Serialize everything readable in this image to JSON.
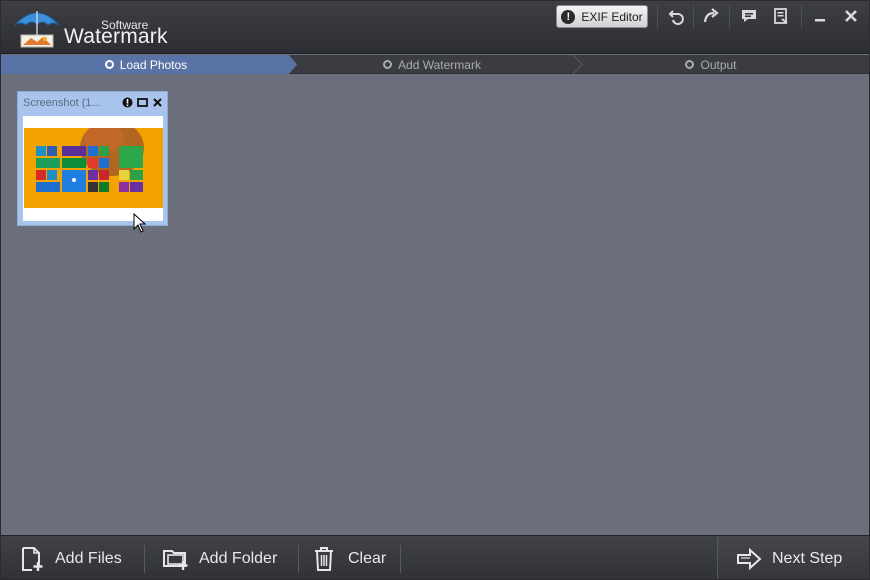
{
  "app": {
    "brand_small": "Software",
    "brand_big": "Watermark"
  },
  "toolbar": {
    "exif_label": "EXIF Editor",
    "exif_icon": "exclamation-circle-icon",
    "icons": [
      "undo-icon",
      "redo-icon",
      "feedback-icon",
      "register-icon",
      "minimize-icon",
      "close-icon"
    ]
  },
  "steps": [
    {
      "label": "Load Photos",
      "active": true
    },
    {
      "label": "Add Watermark",
      "active": false
    },
    {
      "label": "Output",
      "active": false
    }
  ],
  "photos": [
    {
      "title": "Screenshot (1..."
    }
  ],
  "bottom": {
    "add_files": "Add Files",
    "add_folder": "Add Folder",
    "clear": "Clear",
    "next_step": "Next Step"
  },
  "colors": {
    "active_step": "#5a73a6",
    "content_bg": "#6b6f7b",
    "thumb_selected": "#a9c4ec"
  }
}
